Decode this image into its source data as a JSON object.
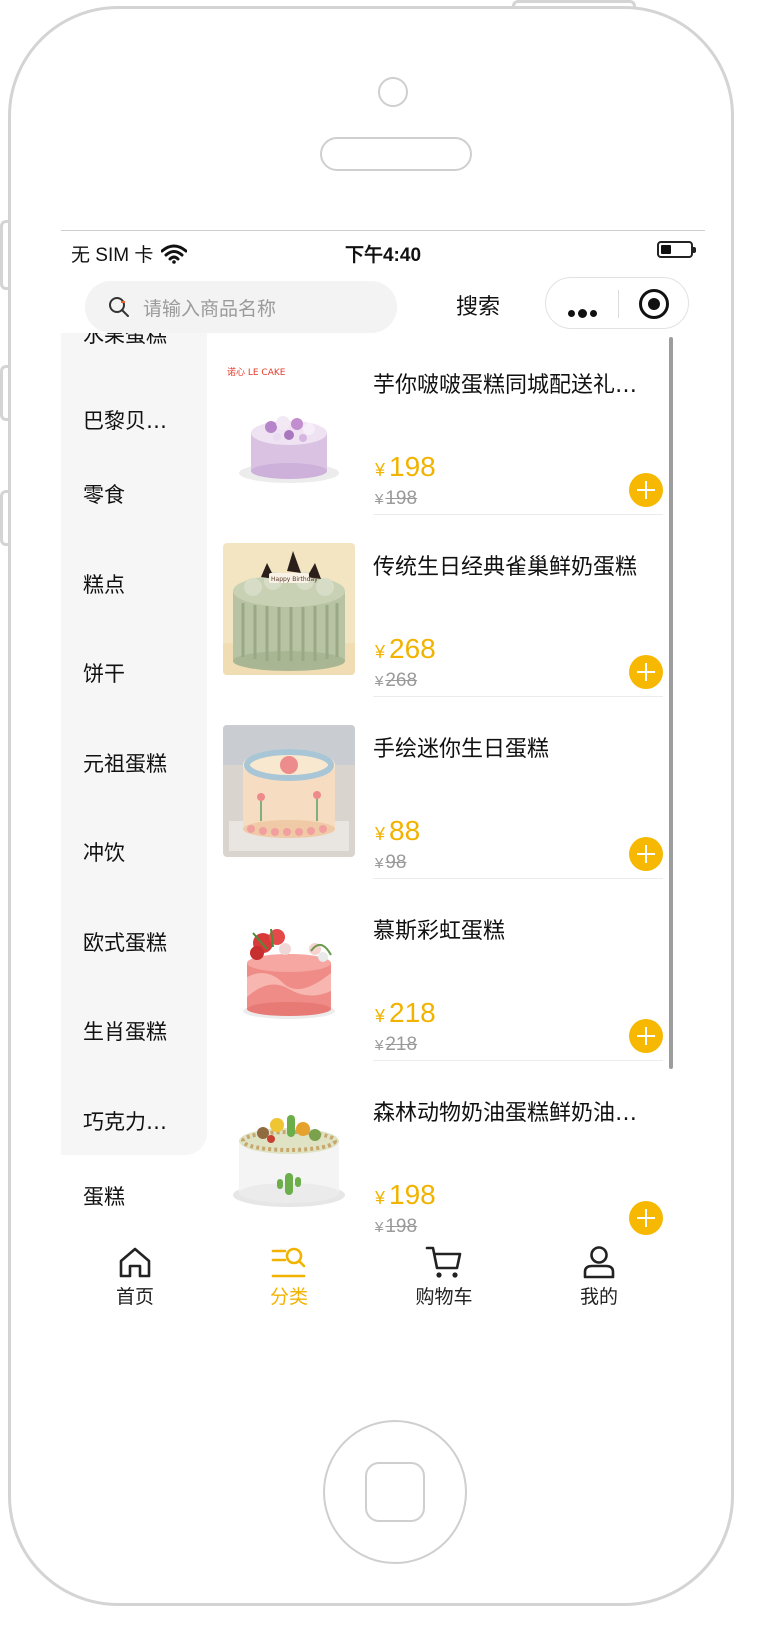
{
  "status_bar": {
    "carrier": "无 SIM 卡",
    "time": "下午4:40"
  },
  "search": {
    "placeholder": "请输入商品名称",
    "button": "搜索"
  },
  "categories": {
    "partial_top": "水果蛋糕",
    "items": [
      "巴黎贝…",
      "零食",
      "糕点",
      "饼干",
      "元祖蛋糕",
      "冲饮",
      "欧式蛋糕",
      "生肖蛋糕",
      "巧克力…"
    ],
    "below_panel": "蛋糕"
  },
  "products": [
    {
      "title": "芋你啵啵蛋糕同城配送礼…",
      "price": "198",
      "original_price": "198",
      "brand_label": "LE CAKE"
    },
    {
      "title": "传统生日经典雀巢鲜奶蛋糕",
      "price": "268",
      "original_price": "268",
      "cake_plaque": "Happy Birthday"
    },
    {
      "title": "手绘迷你生日蛋糕",
      "price": "88",
      "original_price": "98"
    },
    {
      "title": "慕斯彩虹蛋糕",
      "price": "218",
      "original_price": "218"
    },
    {
      "title": "森林动物奶油蛋糕鲜奶油…",
      "price": "198",
      "original_price": "198"
    }
  ],
  "currency_symbol": "¥",
  "tabs": [
    {
      "label": "首页",
      "icon": "home-icon",
      "active": false
    },
    {
      "label": "分类",
      "icon": "category-search-icon",
      "active": true
    },
    {
      "label": "购物车",
      "icon": "cart-icon",
      "active": false
    },
    {
      "label": "我的",
      "icon": "user-icon",
      "active": false
    }
  ],
  "colors": {
    "accent": "#f2b300",
    "add_button": "#f6b800",
    "sidebar_bg": "#f6f6f6",
    "search_bg": "#f3f3f3"
  }
}
